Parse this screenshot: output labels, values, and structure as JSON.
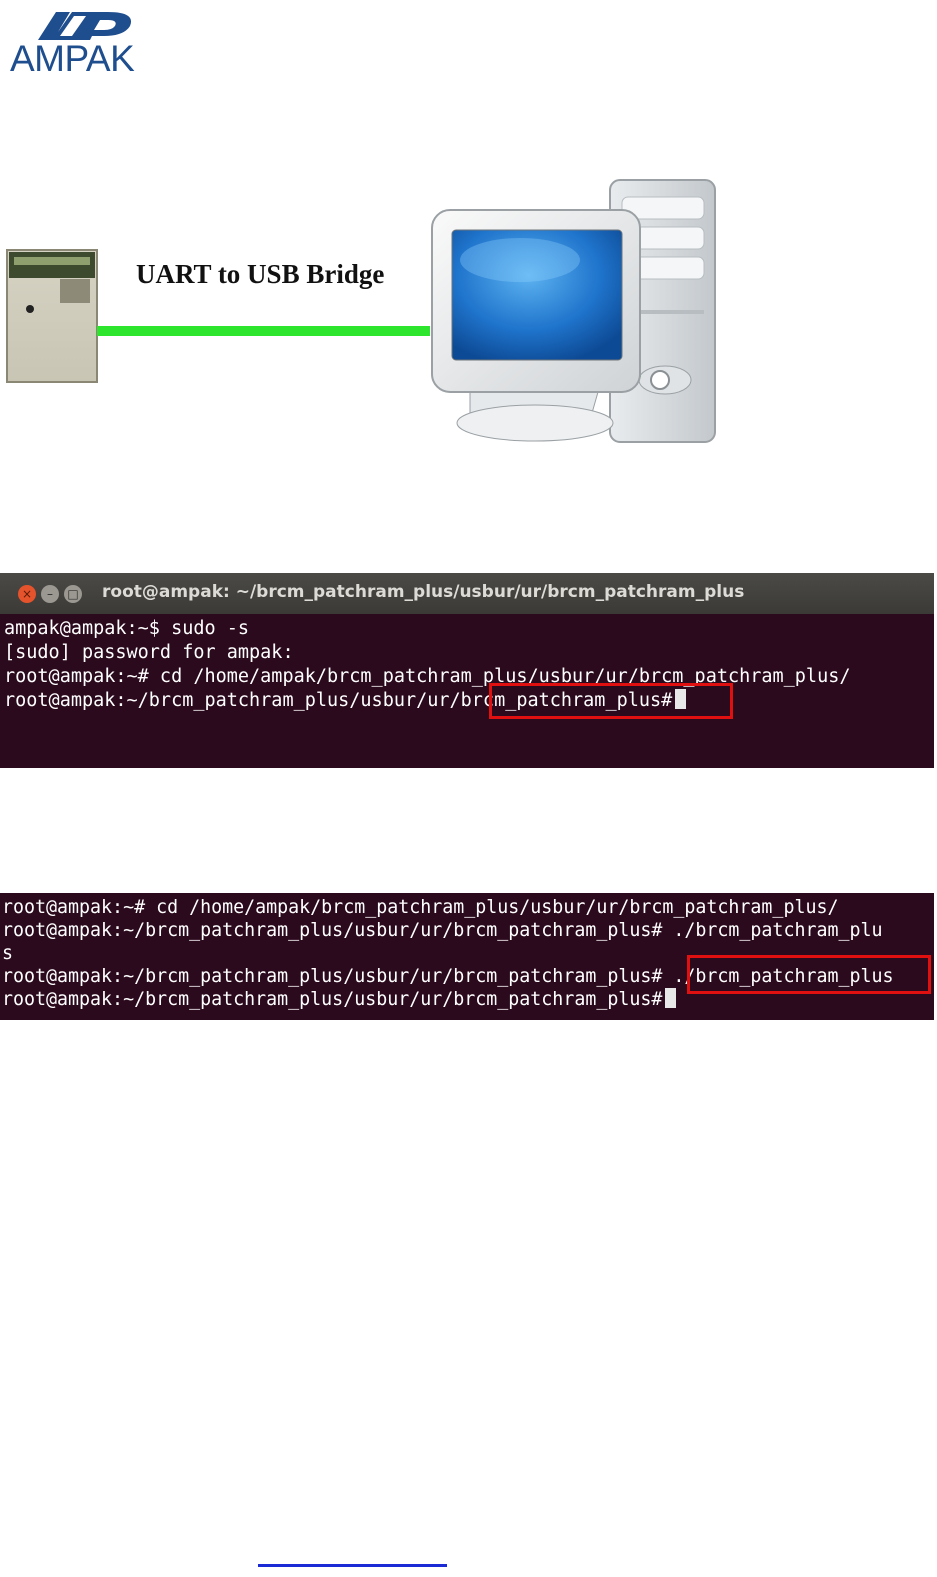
{
  "logo": {
    "brand": "AMPAK"
  },
  "diagram": {
    "label": "UART to USB Bridge",
    "colors": {
      "line": "#2ee52e",
      "screen": "#1f74cc"
    }
  },
  "terminal1": {
    "title": "root@ampak: ~/brcm_patchram_plus/usbur/ur/brcm_patchram_plus",
    "lines": [
      "ampak@ampak:~$ sudo -s",
      "[sudo] password for ampak:",
      "root@ampak:~# cd /home/ampak/brcm_patchram_plus/usbur/ur/brcm_patchram_plus/",
      "root@ampak:~/brcm_patchram_plus/usbur/ur/brcm_patchram_plus#"
    ]
  },
  "terminal2": {
    "lines": [
      "root@ampak:~# cd /home/ampak/brcm_patchram_plus/usbur/ur/brcm_patchram_plus/",
      "root@ampak:~/brcm_patchram_plus/usbur/ur/brcm_patchram_plus# ./brcm_patchram_plu",
      "s",
      "root@ampak:~/brcm_patchram_plus/usbur/ur/brcm_patchram_plus# ./brcm_patchram_plus",
      "root@ampak:~/brcm_patchram_plus/usbur/ur/brcm_patchram_plus#"
    ]
  }
}
